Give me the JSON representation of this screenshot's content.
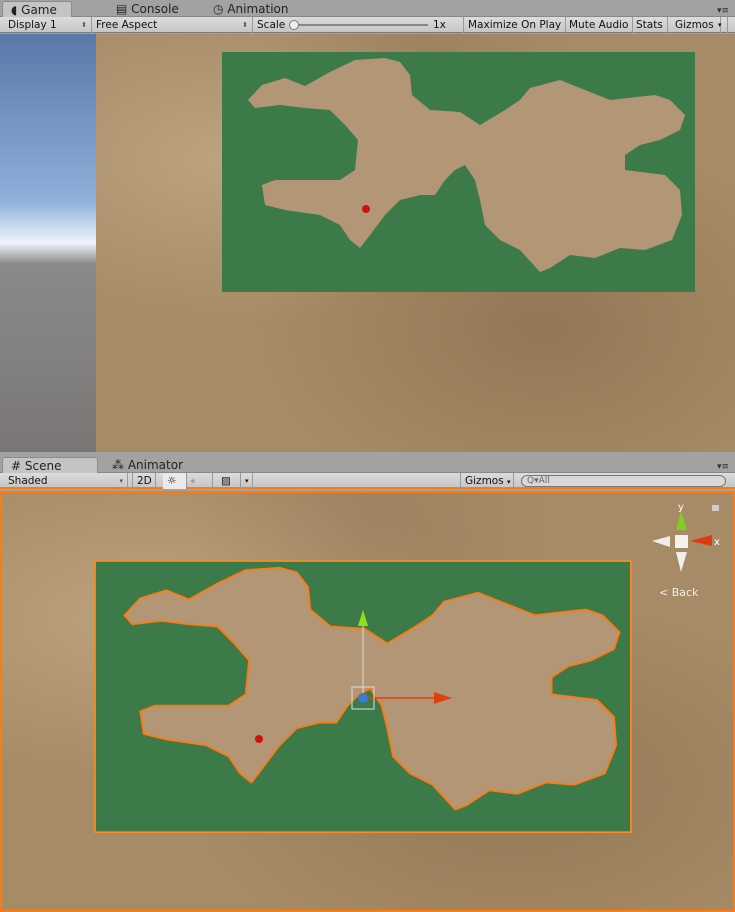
{
  "game_panel": {
    "tabs": [
      {
        "label": "Game",
        "icon": "pacman-icon",
        "active": true
      },
      {
        "label": "Console",
        "icon": "console-icon"
      },
      {
        "label": "Animation",
        "icon": "clock-icon"
      }
    ],
    "toolbar": {
      "display": "Display 1",
      "aspect": "Free Aspect",
      "scale_label": "Scale",
      "scale_value": "1x",
      "scale_fraction": 0,
      "maximize": "Maximize On Play",
      "mute": "Mute Audio",
      "stats": "Stats",
      "gizmos": "Gizmos"
    }
  },
  "scene_panel": {
    "tabs": [
      {
        "label": "Scene",
        "icon": "hash-icon",
        "active": true
      },
      {
        "label": "Animator",
        "icon": "animator-icon"
      }
    ],
    "toolbar": {
      "shading": "Shaded",
      "mode_2d": "2D",
      "gizmos": "Gizmos",
      "search_placeholder": "All"
    },
    "orientation_gizmo": {
      "y": "y",
      "x": "x",
      "back": "Back"
    }
  },
  "colors": {
    "ground": "#a78a66",
    "grass": "#3d7a4a",
    "selection": "#ff7a10",
    "sky_top": "#5a78a8"
  }
}
